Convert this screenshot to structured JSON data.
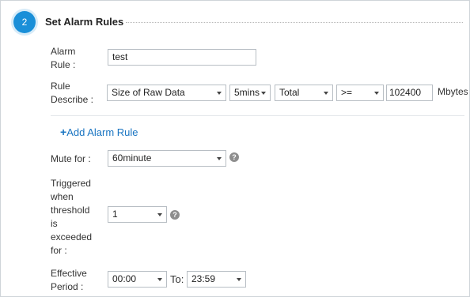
{
  "step": {
    "number": "2",
    "title": "Set Alarm Rules"
  },
  "alarm_rule": {
    "label": "Alarm\nRule :",
    "value": "test"
  },
  "rule_describe": {
    "label": "Rule\nDescribe :",
    "metric": "Size of Raw Data",
    "period": "5mins",
    "statistic": "Total",
    "operator": ">=",
    "threshold": "102400",
    "unit": "Mbytes"
  },
  "add_rule": {
    "plus": "+",
    "label": "Add Alarm Rule"
  },
  "mute_for": {
    "label": "Mute for :",
    "value": "60minute",
    "help": "?"
  },
  "triggered": {
    "label": "Triggered\nwhen\nthreshold\nis\nexceeded\nfor :",
    "value": "1",
    "help": "?"
  },
  "effective_period": {
    "label": "Effective\nPeriod :",
    "start": "00:00",
    "to_label": "To:",
    "end": "23:59"
  },
  "colors": {
    "accent": "#1a8fd8",
    "link": "#1a75c2"
  },
  "icons": {
    "dropdown": "chevron-down-icon",
    "help": "question-circle-icon",
    "add": "plus-icon"
  }
}
